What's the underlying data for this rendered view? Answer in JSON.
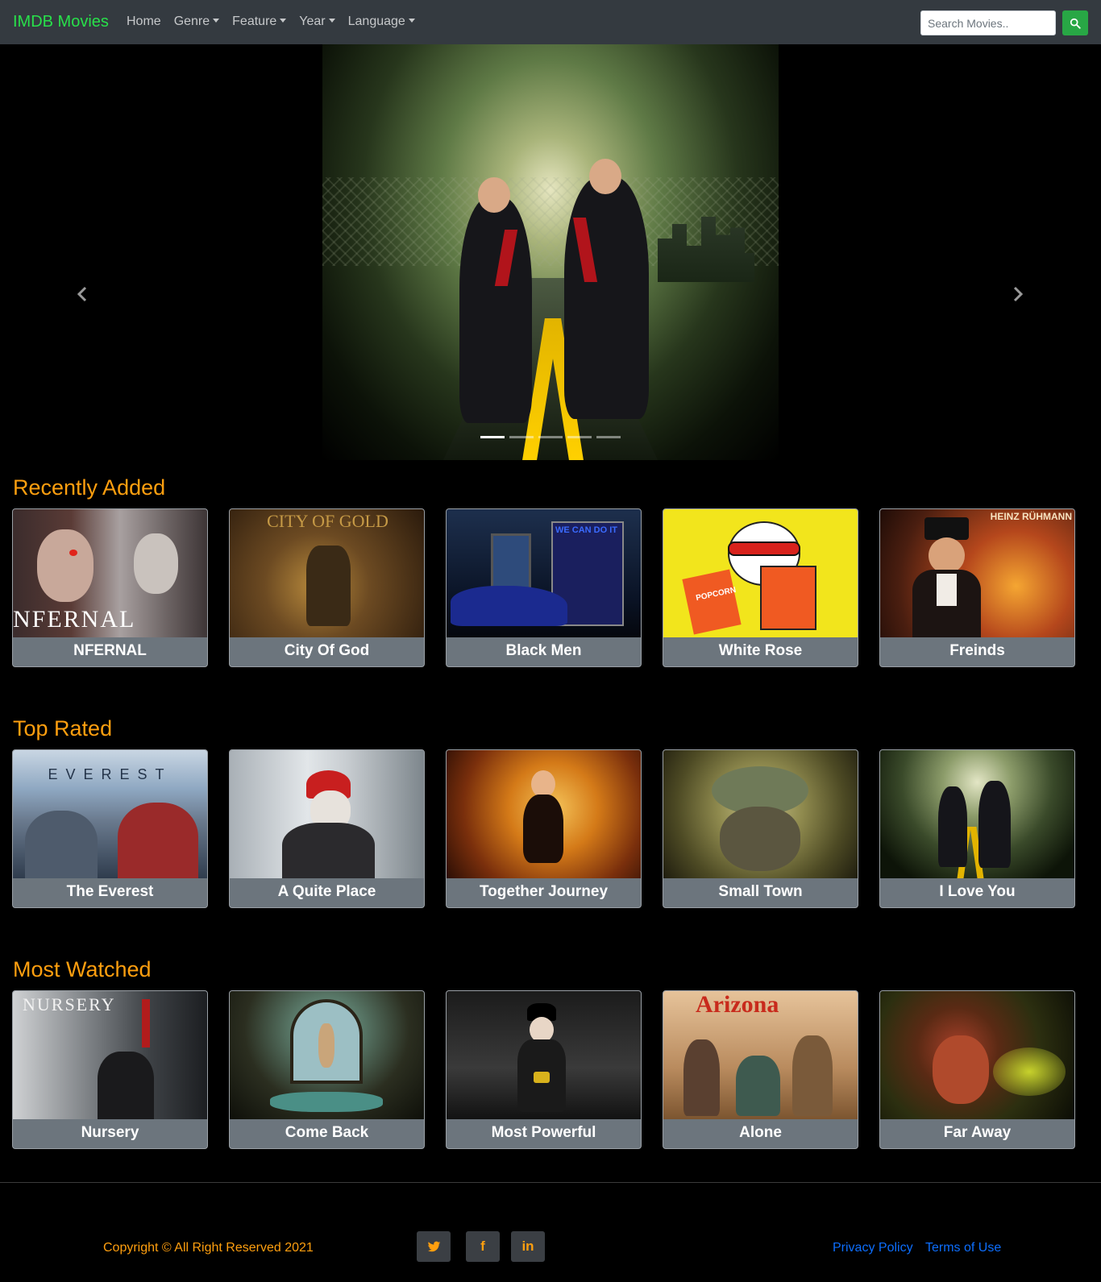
{
  "navbar": {
    "brand": "IMDB Movies",
    "links": [
      {
        "label": "Home",
        "dropdown": false
      },
      {
        "label": "Genre",
        "dropdown": true
      },
      {
        "label": "Feature",
        "dropdown": true
      },
      {
        "label": "Year",
        "dropdown": true
      },
      {
        "label": "Language",
        "dropdown": true
      }
    ],
    "search_placeholder": "Search Movies..",
    "search_icon": "search-icon"
  },
  "hero": {
    "slide_count": 5,
    "active_slide": 1,
    "prev_icon": "chevron-left-icon",
    "next_icon": "chevron-right-icon"
  },
  "sections": [
    {
      "title": "Recently Added",
      "movies": [
        "NFERNAL",
        "City Of God",
        "Black Men",
        "White Rose",
        "Freinds"
      ]
    },
    {
      "title": "Top Rated",
      "movies": [
        "The Everest",
        "A Quite Place",
        "Together Journey",
        "Small Town",
        "I Love You"
      ]
    },
    {
      "title": "Most Watched",
      "movies": [
        "Nursery",
        "Come Back",
        "Most Powerful",
        "Alone",
        "Far Away"
      ]
    }
  ],
  "poster_text": {
    "nfernal": "NFERNAL",
    "city": "CITY OF GOLD",
    "black": "WE CAN DO IT",
    "white": "POPCORN",
    "freinds_top": "HEINZ RÜHMANN",
    "everest": "EVEREST",
    "nursery": "NURSERY",
    "alone": "Arizona"
  },
  "footer": {
    "copyright": "Copyright © All Right Reserved 2021",
    "social": [
      {
        "icon": "twitter-icon",
        "glyph": "🐦"
      },
      {
        "icon": "facebook-icon",
        "glyph": "f"
      },
      {
        "icon": "linkedin-icon",
        "glyph": "in"
      }
    ],
    "links": [
      "Privacy Policy",
      "Terms of Use"
    ]
  },
  "colors": {
    "accent": "#ff9f0f",
    "brand": "#28e04a",
    "navbar": "#343a40",
    "search_button": "#28a745",
    "link": "#0d6efd"
  }
}
